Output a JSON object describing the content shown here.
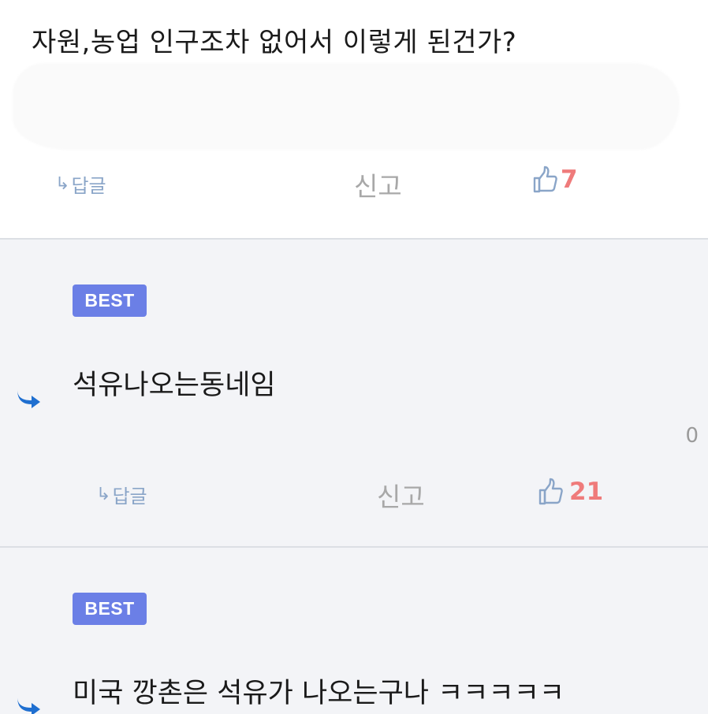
{
  "comments": [
    {
      "text": "자원,농업 인구조차 없어서 이렇게 된건가?",
      "reply_label": "답글",
      "report_label": "신고",
      "like_count": "7"
    },
    {
      "badge": "BEST",
      "text": "석유나오는동네임",
      "stray": "0",
      "reply_label": "답글",
      "report_label": "신고",
      "like_count": "21"
    },
    {
      "badge": "BEST",
      "text": "미국 깡촌은 석유가 나오는구나 ㅋㅋㅋㅋㅋ"
    }
  ],
  "icons": {
    "reply_arrow": "reply-arrow-icon",
    "thumbs_up": "thumbs-up-icon",
    "reply_indicator": "reply-indicator-icon"
  },
  "colors": {
    "best_badge": "#6b7fe6",
    "like_count": "#ef7b7b",
    "reply_link": "#8aa5c8",
    "reply_indicator": "#1f6fd0",
    "best_background": "#f3f4f7"
  }
}
